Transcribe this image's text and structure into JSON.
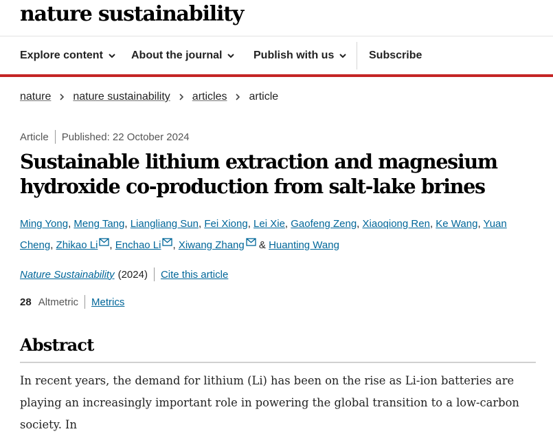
{
  "header": {
    "logo": "nature sustainability"
  },
  "nav": {
    "explore": "Explore content",
    "about": "About the journal",
    "publish": "Publish with us",
    "subscribe": "Subscribe"
  },
  "breadcrumb": [
    "nature",
    "nature sustainability",
    "articles",
    "article"
  ],
  "article": {
    "type": "Article",
    "published": "Published: 22 October 2024",
    "title": "Sustainable lithium extraction and magnesium hydroxide co-production from salt-lake brines",
    "authors": [
      "Ming Yong",
      "Meng Tang",
      "Liangliang Sun",
      "Fei Xiong",
      "Lei Xie",
      "Gaofeng Zeng",
      "Xiaoqiong Ren",
      "Ke Wang",
      "Yuan Cheng",
      "Zhikao Li",
      "Enchao Li",
      "Xiwang Zhang",
      "Huanting Wang"
    ],
    "author_joiner": "&",
    "journal": "Nature Sustainability",
    "year": "(2024)",
    "cite": "Cite this article",
    "altmetric_count": "28",
    "altmetric_label": "Altmetric",
    "metrics_link": "Metrics"
  },
  "abstract": {
    "heading": "Abstract",
    "text": "In recent years, the demand for lithium (Li) has been on the rise as Li-ion batteries are playing an increasingly important role in powering the global transition to a low-carbon society. In"
  },
  "colors": {
    "accent_red": "#c42525",
    "link": "#006699"
  }
}
